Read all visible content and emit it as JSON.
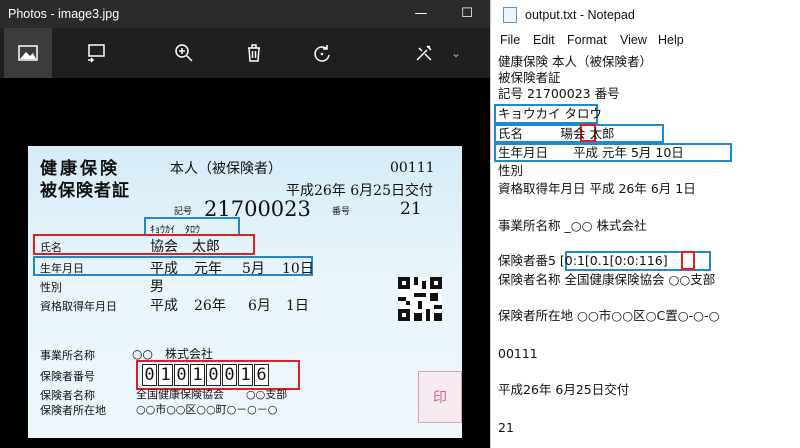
{
  "photos": {
    "title": "Photos - image3.jpg",
    "window_controls": {
      "minimize": "—",
      "maximize": "☐"
    },
    "toolbar": [
      "image-icon",
      "slideshow-icon",
      "zoom-in-icon",
      "delete-icon",
      "rotate-icon",
      "edit-icon"
    ],
    "toolbar_more": "⌄"
  },
  "card": {
    "title_line1": "健康保険",
    "title_line2": "被保険者証",
    "relation": "本人（被保険者）",
    "card_code": "00111",
    "issue_date": "平成26年 6月25日交付",
    "kigou_label": "記号",
    "kigou_value": "21700023",
    "bangou_label": "番号",
    "bangou_value": "21",
    "furigana": "ｷｮｳｶｲ　ﾀﾛｳ",
    "name_label": "氏名",
    "name_value": "協会　太郎",
    "dob_label": "生年月日",
    "dob_era": "平成",
    "dob_year": "元年",
    "dob_month": "5月",
    "dob_day": "10日",
    "sex_label": "性別",
    "sex_value": "男",
    "acq_label": "資格取得年月日",
    "acq_era": "平成",
    "acq_year": "26年",
    "acq_month": "6月",
    "acq_day": "1日",
    "office_label": "事業所名称",
    "office_value": "○○　株式会社",
    "insurer_no_label": "保険者番号",
    "insurer_no_digits": [
      "0",
      "1",
      "0",
      "1",
      "0",
      "0",
      "1",
      "6"
    ],
    "insurer_name_label": "保険者名称",
    "insurer_name_value": "全国健康保険協会　　○○支部",
    "insurer_addr_label": "保険者所在地",
    "insurer_addr_value": "○○市○○区○○町○－○－○",
    "seal": "印"
  },
  "notepad": {
    "title": "output.txt - Notepad",
    "menu": [
      "File",
      "Edit",
      "Format",
      "View",
      "Help"
    ],
    "lines": [
      "健康保険 本人（被保険者）",
      "被保険者証",
      "記号 21700023 番号",
      "キョウカイ タロウ",
      "氏名　　　瑒会 太郎",
      "生年月日　　平成 元年 5月 10日",
      "性別",
      "資格取得年月日 平成 26年 6月 1日",
      "",
      "事業所名称 _○○ 株式会社",
      "",
      "保険者番5 [0:1[0.1[0:0:116]",
      "保険者名称 全国健康保険協会 ○○支部",
      "",
      "保険者所在地 ○○市○○区○C置○-○-○",
      "",
      "00111",
      "",
      "平成26年 6月25日交付",
      "",
      "21"
    ]
  }
}
